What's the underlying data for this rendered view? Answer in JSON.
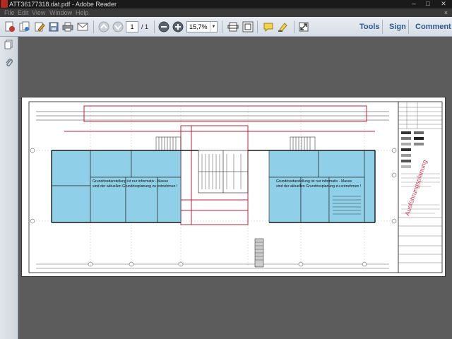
{
  "window": {
    "title": "ATT36177318.dat.pdf - Adobe Reader",
    "minimize_icon": "minimize-icon",
    "maximize_icon": "maximize-icon",
    "close_icon": "close-icon"
  },
  "menu": {
    "items": [
      "File",
      "Edit",
      "View",
      "Window",
      "Help"
    ],
    "close_glyph": "×"
  },
  "toolbar": {
    "page_current": "1",
    "page_total": "/ 1",
    "zoom": "15,7%",
    "tools_label": "Tools",
    "sign_label": "Sign",
    "comment_label": "Comment"
  },
  "drawing": {
    "annotation_left_line1": "Grundrissdarstellung ist nur informativ - Masse",
    "annotation_left_line2": "sind der aktuellen Grundrissplanung zu entnehmen !",
    "annotation_right_line1": "Grundrissdarstellung ist nur informativ - Masse",
    "annotation_right_line2": "sind der aktuellen Grundrissplanung zu entnehmen !",
    "stamp_text": "Ausführungsplanung",
    "colors": {
      "room_fill": "#8fd0e8",
      "red_line": "#c0203a",
      "wall": "#1a1a1a"
    }
  }
}
